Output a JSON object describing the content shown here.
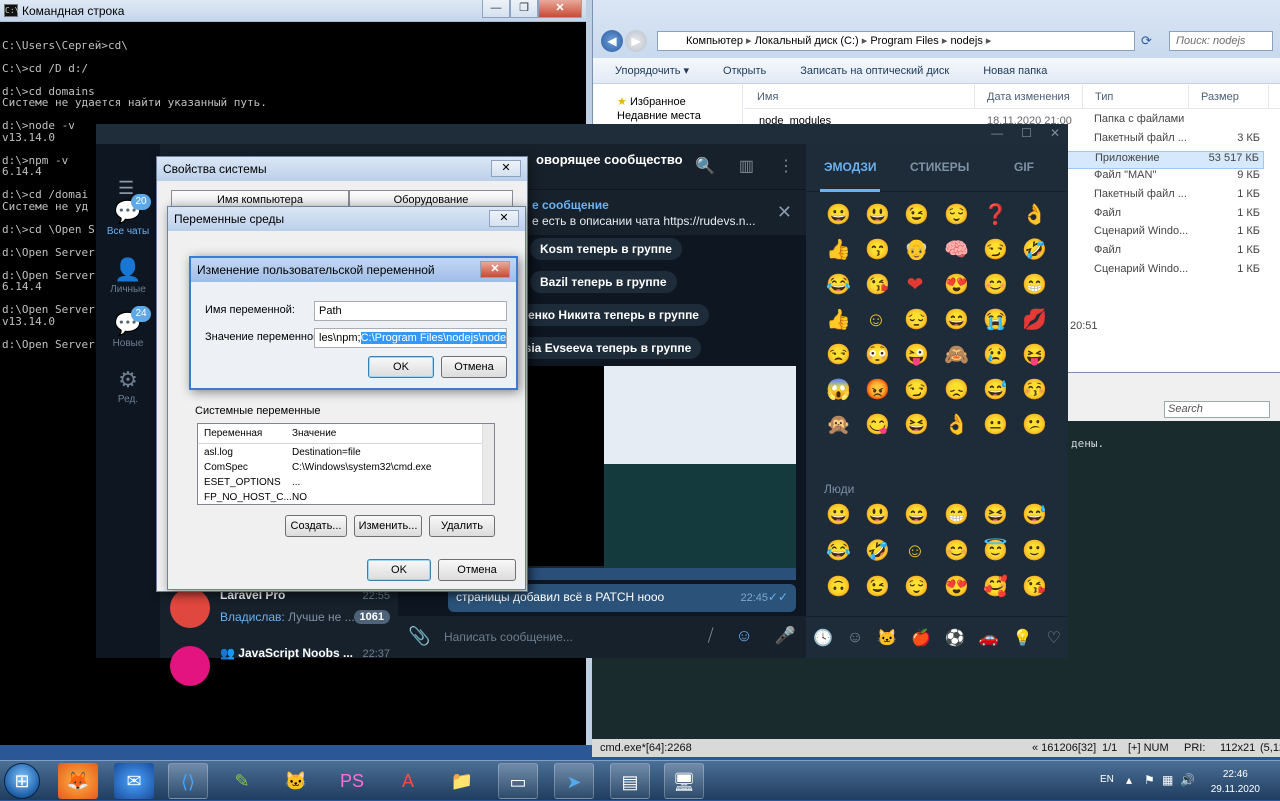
{
  "cmd": {
    "title": "Командная строка",
    "lines": [
      "",
      "C:\\Users\\Сергей>cd\\",
      "",
      "C:\\>cd /D d:/",
      "",
      "d:\\>cd domains",
      "Системе не удается найти указанный путь.",
      "",
      "d:\\>node -v",
      "v13.14.0",
      "",
      "d:\\>npm -v",
      "6.14.4",
      "",
      "d:\\>cd /domai",
      "Системе не уд",
      "",
      "d:\\>cd \\Open S",
      "",
      "d:\\Open Server",
      "",
      "d:\\Open Server",
      "6.14.4",
      "",
      "d:\\Open Server",
      "v13.14.0",
      "",
      "d:\\Open Server"
    ]
  },
  "explorer": {
    "breadcrumbs": [
      "Компьютер",
      "Локальный диск (C:)",
      "Program Files",
      "nodejs"
    ],
    "search_placeholder": "Поиск: nodejs",
    "toolbar": [
      "Упорядочить ▾",
      "Открыть",
      "Записать на оптический диск",
      "Новая папка"
    ],
    "nav": [
      "Избранное",
      "Недавние места"
    ],
    "columns": [
      "Имя",
      "Дата изменения",
      "Тип",
      "Размер"
    ],
    "visible_file": "node_modules",
    "visible_date": "18.11.2020 21:00",
    "rows": [
      {
        "type": "Папка с файлами",
        "size": ""
      },
      {
        "type": "Пакетный файл ...",
        "size": "3 КБ"
      },
      {
        "type": "Приложение",
        "size": "53 517 КБ"
      },
      {
        "type": "Файл \"MAN\"",
        "size": "9 КБ"
      },
      {
        "type": "Пакетный файл ...",
        "size": "1 КБ"
      },
      {
        "type": "Файл",
        "size": "1 КБ"
      },
      {
        "type": "Сценарий Windo...",
        "size": "1 КБ"
      },
      {
        "type": "Файл",
        "size": "1 КБ"
      },
      {
        "type": "Сценарий Windo...",
        "size": "1 КБ"
      }
    ],
    "time_fragment": "20:51"
  },
  "terminal": {
    "search_placeholder": "Search",
    "line": "дены.",
    "status_left": "cmd.exe*[64]:2268",
    "status_pos": "« 161206[32]",
    "status_page": "1/1",
    "status_flags": "[+] NUM",
    "status_pri": "PRI:",
    "status_size": "112x21",
    "status_coord": "(5,12"
  },
  "telegram": {
    "folders": [
      {
        "label": "Все чаты",
        "badge": "20"
      },
      {
        "label": "Личные",
        "badge": ""
      },
      {
        "label": "Новые",
        "badge": "24"
      },
      {
        "label": "Ред.",
        "badge": ""
      }
    ],
    "chat_title": "оворящее сообщество",
    "pinned_label": "е сообщение",
    "pinned_text": "е есть в описании чата https://rudevs.n...",
    "service_msgs": [
      "Kosm теперь в группе",
      "Bazil теперь в группе",
      "шенко Никита теперь в группе",
      "esia Evseeva теперь в группе"
    ],
    "last_msg": "страницы добавил всё в PATCH нооо",
    "last_msg_time": "22:45",
    "chats": [
      {
        "name": "Laravel Pro",
        "sender": "",
        "preview": "",
        "time": "22:55",
        "unread": ""
      },
      {
        "name": "",
        "sender": "Владислав:",
        "preview": " Лучше не ...",
        "time": "",
        "unread": "1061"
      },
      {
        "name": "JavaScript Noobs ...",
        "sender": "",
        "preview": "",
        "time": "22:37",
        "unread": ""
      }
    ],
    "compose_placeholder": "Написать сообщение...",
    "emoji_tabs": [
      "ЭМОДЗИ",
      "СТИКЕРЫ",
      "GIF"
    ],
    "people_label": "Люди"
  },
  "sysprops": {
    "title": "Свойства системы",
    "tabs": [
      "Имя компьютера",
      "Оборудование"
    ],
    "ok": "OK",
    "cancel": "Отмена"
  },
  "envvars": {
    "title": "Переменные среды",
    "system_group": "Системные переменные",
    "col_var": "Переменная",
    "col_val": "Значение",
    "rows": [
      {
        "name": "asl.log",
        "value": "Destination=file"
      },
      {
        "name": "ComSpec",
        "value": "C:\\Windows\\system32\\cmd.exe"
      },
      {
        "name": "ESET_OPTIONS",
        "value": "                                        ..."
      },
      {
        "name": "FP_NO_HOST_C...",
        "value": "NO"
      }
    ],
    "create": "Создать...",
    "edit": "Изменить...",
    "delete": "Удалить",
    "ok": "OK",
    "cancel": "Отмена"
  },
  "editvar": {
    "title": "Изменение пользовательской переменной",
    "name_label": "Имя переменной:",
    "name_value": "Path",
    "value_label": "Значение переменной:",
    "value_prefix": "les\\npm;",
    "value_selected": "C:\\Program Files\\nodejs\\node.exe",
    "ok": "OK",
    "cancel": "Отмена"
  },
  "tray": {
    "lang": "EN",
    "time": "22:46",
    "date": "29.11.2020"
  }
}
